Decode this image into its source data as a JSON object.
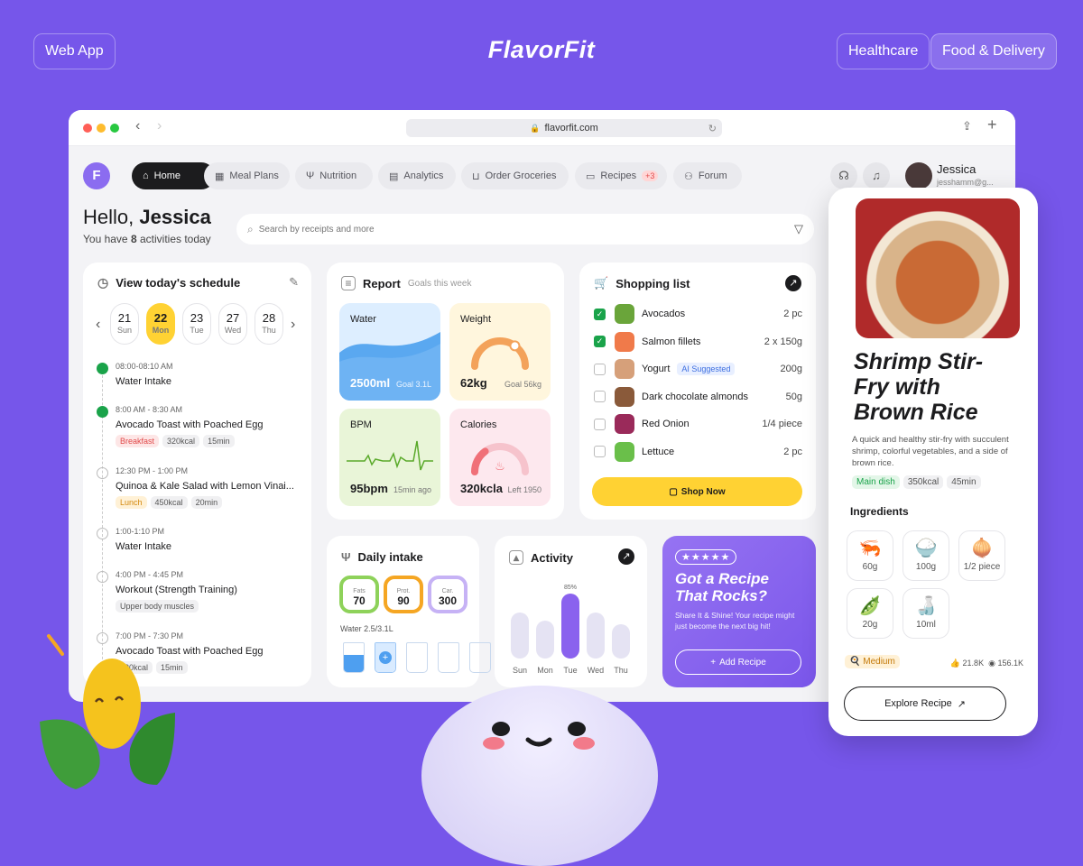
{
  "top": {
    "left_pill": "Web App",
    "brand": "FlavorFit",
    "right_pills": [
      "Healthcare",
      "Food & Delivery"
    ]
  },
  "browser": {
    "url": "flavorfit.com"
  },
  "nav": {
    "logo_letter": "F",
    "items": [
      {
        "label": "Home",
        "icon": "home-icon"
      },
      {
        "label": "Meal Plans",
        "icon": "calendar-icon"
      },
      {
        "label": "Nutrition",
        "icon": "utensils-icon"
      },
      {
        "label": "Analytics",
        "icon": "chart-icon"
      },
      {
        "label": "Order Groceries",
        "icon": "basket-icon"
      },
      {
        "label": "Recipes",
        "icon": "book-icon",
        "badge": "+3"
      },
      {
        "label": "Forum",
        "icon": "users-icon"
      }
    ],
    "user_name": "Jessica",
    "user_email": "jesshamm@g..."
  },
  "greeting": {
    "hello": "Hello, ",
    "name": "Jessica",
    "line_pre": "You have ",
    "count": "8",
    "line_post": " activities today"
  },
  "search": {
    "placeholder": "Search by receipts and more"
  },
  "schedule": {
    "title": "View today's schedule",
    "days": [
      {
        "n": "21",
        "d": "Sun"
      },
      {
        "n": "22",
        "d": "Mon"
      },
      {
        "n": "23",
        "d": "Tue"
      },
      {
        "n": "27",
        "d": "Wed"
      },
      {
        "n": "28",
        "d": "Thu"
      }
    ],
    "events": [
      {
        "time": "08:00-08:10 AM",
        "name": "Water Intake",
        "tags": [],
        "done": true
      },
      {
        "time": "8:00 AM - 8:30 AM",
        "name": "Avocado Toast with Poached Egg",
        "tags": [
          "Breakfast",
          "320kcal",
          "15min"
        ],
        "done": true
      },
      {
        "time": "12:30 PM - 1:00 PM",
        "name": "Quinoa & Kale Salad with Lemon Vinai...",
        "tags": [
          "Lunch",
          "450kcal",
          "20min"
        ],
        "done": false
      },
      {
        "time": "1:00-1:10 PM",
        "name": "Water Intake",
        "tags": [],
        "done": false
      },
      {
        "time": "4:00 PM - 4:45 PM",
        "name": "Workout (Strength Training)",
        "tags": [
          "Upper body muscles"
        ],
        "done": false
      },
      {
        "time": "7:00 PM - 7:30 PM",
        "name": "Avocado Toast with Poached Egg",
        "tags": [
          "320kcal",
          "15min"
        ],
        "done": false
      }
    ]
  },
  "report": {
    "title": "Report",
    "subtitle": "Goals this week",
    "water": {
      "label": "Water",
      "value": "2500ml",
      "goal": "Goal 3.1L"
    },
    "weight": {
      "label": "Weight",
      "value": "62kg",
      "goal": "Goal 56kg",
      "fraction": 0.7
    },
    "bpm": {
      "label": "BPM",
      "value": "95bpm",
      "note": "15min ago"
    },
    "calories": {
      "label": "Calories",
      "value": "320kcla",
      "note": "Left 1950",
      "fraction": 0.3
    }
  },
  "shopping": {
    "title": "Shopping list",
    "button": "Shop Now",
    "ai_label": "AI Suggested",
    "items": [
      {
        "name": "Avocados",
        "qty": "2 pc",
        "checked": true,
        "color": "#6aa53a"
      },
      {
        "name": "Salmon fillets",
        "qty": "2 x 150g",
        "checked": true,
        "color": "#f07a4a"
      },
      {
        "name": "Yogurt",
        "qty": "200g",
        "checked": false,
        "ai": true,
        "color": "#d6a07a"
      },
      {
        "name": "Dark chocolate almonds",
        "qty": "50g",
        "checked": false,
        "color": "#8a5a3a"
      },
      {
        "name": "Red Onion",
        "qty": "1/4 piece",
        "checked": false,
        "color": "#9a2a5a"
      },
      {
        "name": "Lettuce",
        "qty": "2 pc",
        "checked": false,
        "color": "#6abf4a"
      }
    ]
  },
  "intake": {
    "title": "Daily intake",
    "rings": [
      {
        "label": "Fats",
        "value": "70",
        "color": "#8ed25a"
      },
      {
        "label": "Prot.",
        "value": "90",
        "color": "#f5a623"
      },
      {
        "label": "Car.",
        "value": "300",
        "color": "#c6b2f5"
      }
    ],
    "water_label": "Water 2.5/3.1L",
    "glasses": [
      1,
      1,
      0,
      0,
      0
    ]
  },
  "activity": {
    "title": "Activity",
    "days": [
      "Sun",
      "Mon",
      "Tue",
      "Wed",
      "Thu"
    ],
    "values": [
      60,
      50,
      85,
      60,
      45
    ],
    "highlight": 2,
    "highlight_label": "85%"
  },
  "promo": {
    "stars": "★★★★★",
    "title": "Got a Recipe That Rocks?",
    "text": "Share It & Shine! Your recipe might just become the next big hit!",
    "button": "Add Recipe"
  },
  "recipe": {
    "title": "Shrimp Stir-Fry with Brown Rice",
    "desc": "A quick and healthy stir-fry with succulent shrimp, colorful vegetables, and a side of brown rice.",
    "tags": [
      "Main dish",
      "350kcal",
      "45min"
    ],
    "ingredients_title": "Ingredients",
    "ingredients": [
      {
        "em": "🦐",
        "q": "60g"
      },
      {
        "em": "🍚",
        "q": "100g"
      },
      {
        "em": "🧅",
        "q": "1/2 piece"
      },
      {
        "em": "🫛",
        "q": "20g"
      },
      {
        "em": "🍶",
        "q": "10ml"
      }
    ],
    "level": "Medium",
    "likes": "21.8K",
    "views": "156.1K",
    "button": "Explore Recipe"
  }
}
